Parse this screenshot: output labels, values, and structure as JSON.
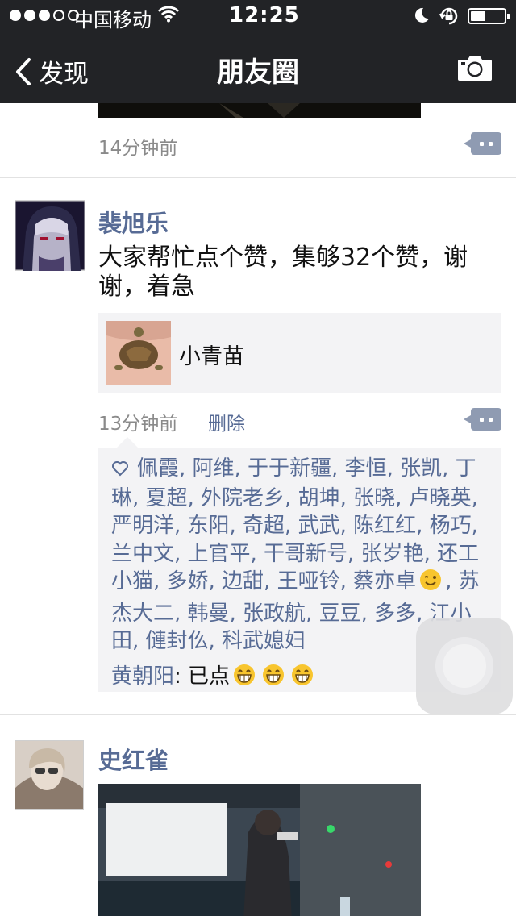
{
  "status_bar": {
    "carrier": "中国移动",
    "time": "12:25",
    "signal_strength": 3,
    "signal_max": 5,
    "battery_level": 0.45,
    "icons": [
      "signal-icon",
      "wifi-icon",
      "moon-icon",
      "rotation-lock-icon",
      "battery-icon"
    ]
  },
  "nav": {
    "back_label": "发现",
    "title": "朋友圈",
    "back_icon": "chevron-left-icon",
    "camera_icon": "camera-icon"
  },
  "feed": {
    "prev_post": {
      "time": "14分钟前",
      "comment_icon": "comment-icon"
    },
    "post1": {
      "author": "裴旭乐",
      "text": "大家帮忙点个赞，集够32个赞，谢谢，着急",
      "share": {
        "title": "小青苗",
        "thumb": "turtle-image"
      },
      "time": "13分钟前",
      "delete_label": "删除",
      "likes_part1": "佩霞, 阿维, 于于新疆, 李恒, 张凯, 丁琳, 夏超, 外院老乡, 胡坤, 张晓, 卢晓英, 严明洋, 东阳, 奇超, 武武, 陈红红, 杨巧, 兰中文, 上官平, 干哥新号, 张岁艳, 还工小猫, 多娇, 边甜, 王哑铃, 蔡亦卓",
      "likes_part2": ", 苏杰大二, 韩曼, 张政航, 豆豆, 多多, 江小田, 僆封仫, 科武媳妇",
      "likes_icon": "heart-icon",
      "comment": {
        "author": "黄朝阳",
        "sep": ": ",
        "text": "已点"
      }
    },
    "post2": {
      "author": "史红雀",
      "media": "video-thumbnail"
    }
  },
  "colors": {
    "nav_bg": "#222326",
    "link_blue": "#576b95",
    "muted_gray": "#8a8a8a",
    "card_bg": "#f3f3f5"
  }
}
